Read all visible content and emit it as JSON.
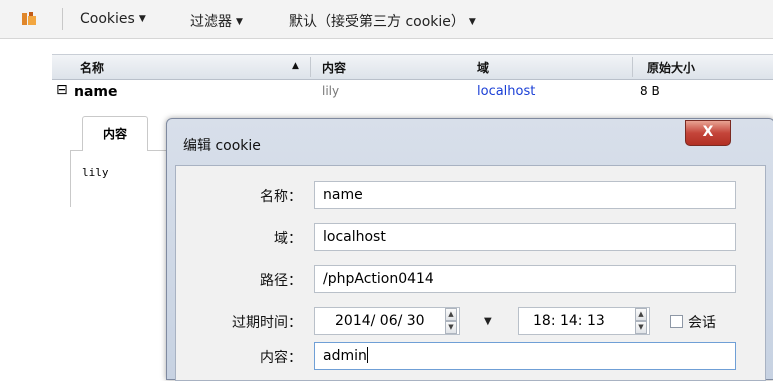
{
  "toolbar": {
    "icon": "cookie-manager-icon",
    "menus": [
      {
        "label": "Cookies"
      },
      {
        "label": "过滤器"
      },
      {
        "label": "默认（接受第三方 cookie）"
      }
    ]
  },
  "table": {
    "columns": [
      "名称",
      "内容",
      "域",
      "原始大小"
    ],
    "sort_indicator": "▲",
    "rows": [
      {
        "expander": "⊟",
        "name": "name",
        "content": "lily",
        "domain": "localhost",
        "size": "8 B"
      }
    ]
  },
  "detail": {
    "tab_label": "内容",
    "value": "lily"
  },
  "dialog": {
    "title": "编辑 cookie",
    "close_label": "X",
    "fields": {
      "name_label": "名称：",
      "name_value": "name",
      "domain_label": "域：",
      "domain_value": "localhost",
      "path_label": "路径：",
      "path_value": "/phpAction0414",
      "expires_label": "过期时间：",
      "expires_date": "2014/ 06/ 30",
      "expires_time": "18: 14: 13",
      "session_label": "会话",
      "session_checked": false,
      "content_label": "内容：",
      "content_value": "admin"
    }
  },
  "colors": {
    "domain_link": "#1a3fd6",
    "muted_text": "#777777",
    "close_button": "#c4453a"
  }
}
